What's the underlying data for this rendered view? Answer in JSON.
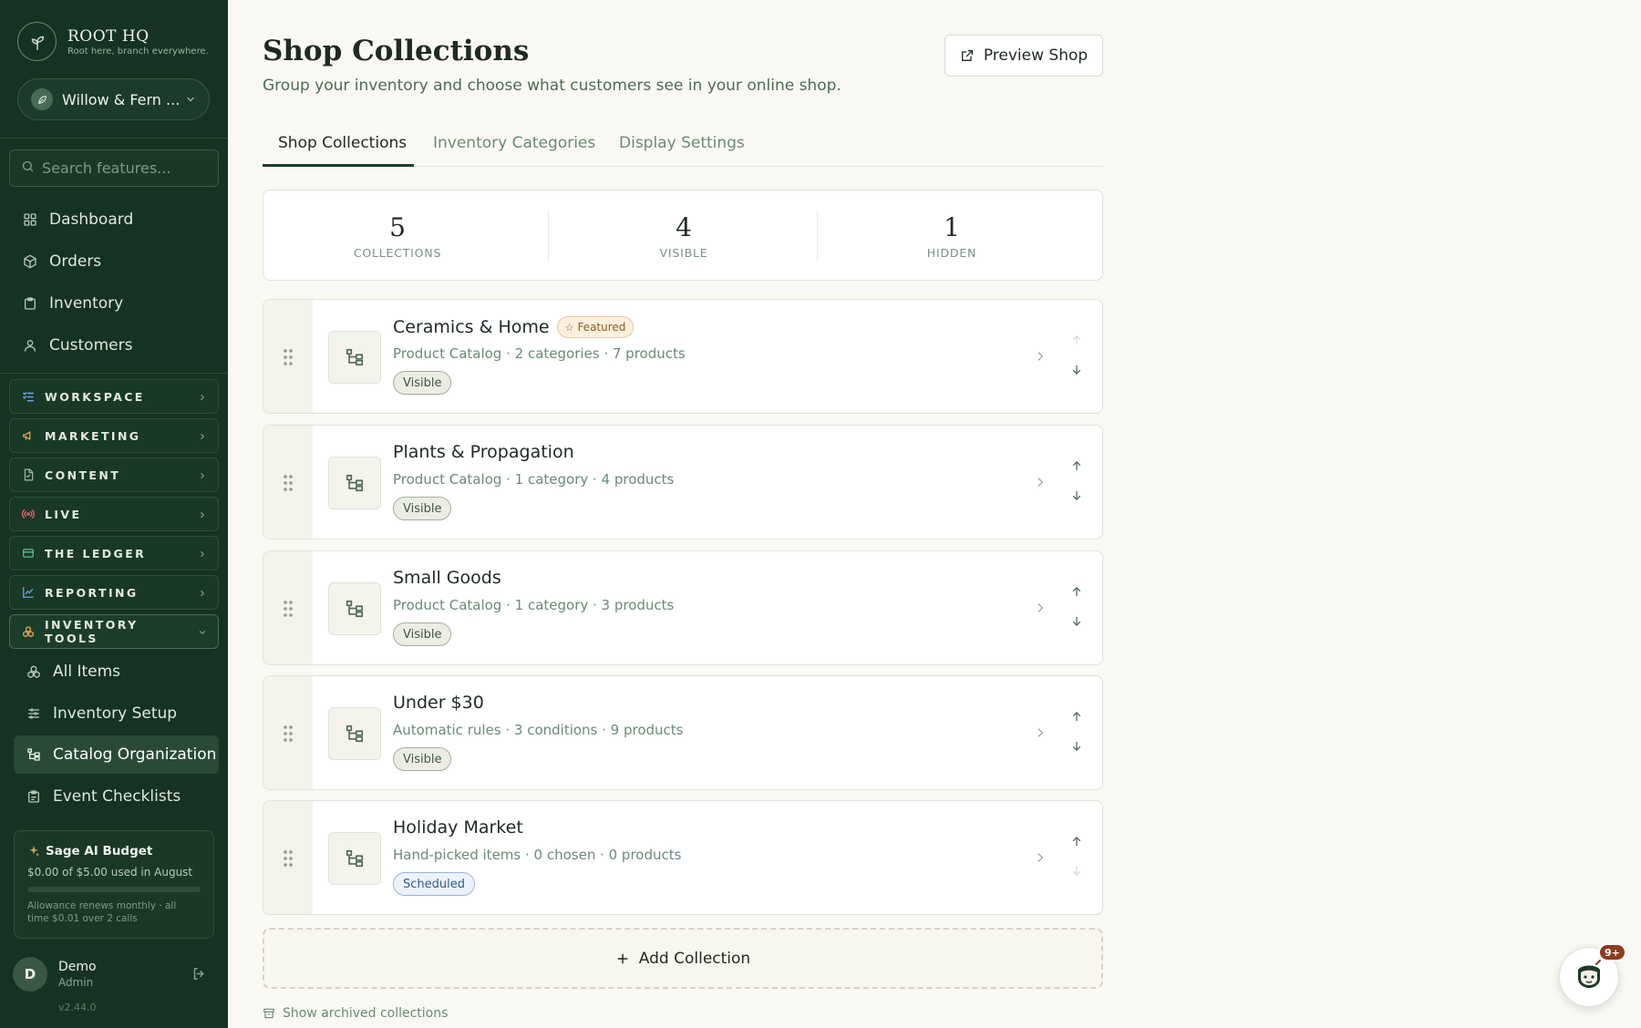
{
  "brand": {
    "name": "ROOT HQ",
    "tagline": "Root here, branch everywhere."
  },
  "tenant": {
    "name": "Willow & Fern ..."
  },
  "search": {
    "placeholder": "Search features..."
  },
  "nav": {
    "dashboard": "Dashboard",
    "orders": "Orders",
    "inventory": "Inventory",
    "customers": "Customers"
  },
  "sections": {
    "workspace": "WORKSPACE",
    "marketing": "MARKETING",
    "content": "CONTENT",
    "live": "LIVE",
    "ledger": "THE LEDGER",
    "reporting": "REPORTING",
    "inventory_tools": "INVENTORY TOOLS"
  },
  "inventory_tools": {
    "all_items": "All Items",
    "setup": "Inventory Setup",
    "catalog": "Catalog Organization",
    "checklists": "Event Checklists"
  },
  "budget": {
    "title": "Sage AI Budget",
    "used": "$0.00 of $5.00 used in August",
    "note": "Allowance renews monthly · all time $0.01 over 2 calls",
    "progress_fraction": 0.0
  },
  "user": {
    "initial": "D",
    "name": "Demo",
    "role": "Admin"
  },
  "version": "v2.44.0",
  "page": {
    "title": "Shop Collections",
    "subtitle": "Group your inventory and choose what customers see in your online shop.",
    "preview_label": "Preview Shop"
  },
  "tabs": {
    "collections": "Shop Collections",
    "categories": "Inventory Categories",
    "display": "Display Settings"
  },
  "stats": {
    "collections": {
      "value": "5",
      "label": "COLLECTIONS"
    },
    "visible": {
      "value": "4",
      "label": "VISIBLE"
    },
    "hidden": {
      "value": "1",
      "label": "HIDDEN"
    }
  },
  "collections": [
    {
      "name": "Ceramics & Home",
      "featured_label": "Featured",
      "meta": "Product Catalog · 2 categories · 7 products",
      "status": "Visible"
    },
    {
      "name": "Plants & Propagation",
      "meta": "Product Catalog · 1 category · 4 products",
      "status": "Visible"
    },
    {
      "name": "Small Goods",
      "meta": "Product Catalog · 1 category · 3 products",
      "status": "Visible"
    },
    {
      "name": "Under $30",
      "meta": "Automatic rules · 3 conditions · 9 products",
      "status": "Visible"
    },
    {
      "name": "Holiday Market",
      "meta": "Hand-picked items · 0 chosen · 0 products",
      "status": "Scheduled"
    }
  ],
  "add_collection": "Add Collection",
  "archived_link": "Show archived collections",
  "chat": {
    "badge": "9+"
  },
  "colors": {
    "sidebar": "#163222",
    "accent": "#1f3b2b",
    "page_bg": "#f9f8f3"
  }
}
